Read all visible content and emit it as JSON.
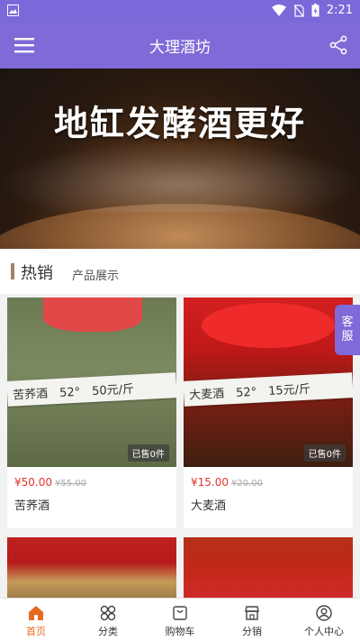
{
  "status_bar": {
    "time": "2:21"
  },
  "app_bar": {
    "title": "大理酒坊"
  },
  "banner": {
    "headline": "地缸发酵酒更好"
  },
  "section": {
    "title": "热销",
    "subtitle": "产品展示"
  },
  "products": [
    {
      "name": "苦荞酒",
      "price": "¥50.00",
      "old_price": "¥55.00",
      "sold": "已售0件",
      "label": "苦荞酒　52°　50元/斤"
    },
    {
      "name": "大麦酒",
      "price": "¥15.00",
      "old_price": "¥20.00",
      "sold": "已售0件",
      "label": "大麦酒　52°　15元/斤"
    }
  ],
  "customer_service": {
    "line1": "客",
    "line2": "服"
  },
  "tabbar": [
    {
      "label": "首页",
      "icon": "home-icon",
      "active": true
    },
    {
      "label": "分类",
      "icon": "category-icon",
      "active": false
    },
    {
      "label": "购物车",
      "icon": "cart-icon",
      "active": false
    },
    {
      "label": "分销",
      "icon": "store-icon",
      "active": false
    },
    {
      "label": "个人中心",
      "icon": "user-icon",
      "active": false
    }
  ],
  "colors": {
    "primary": "#7f6ad8",
    "accent": "#e8691f",
    "price": "#e0352b"
  }
}
